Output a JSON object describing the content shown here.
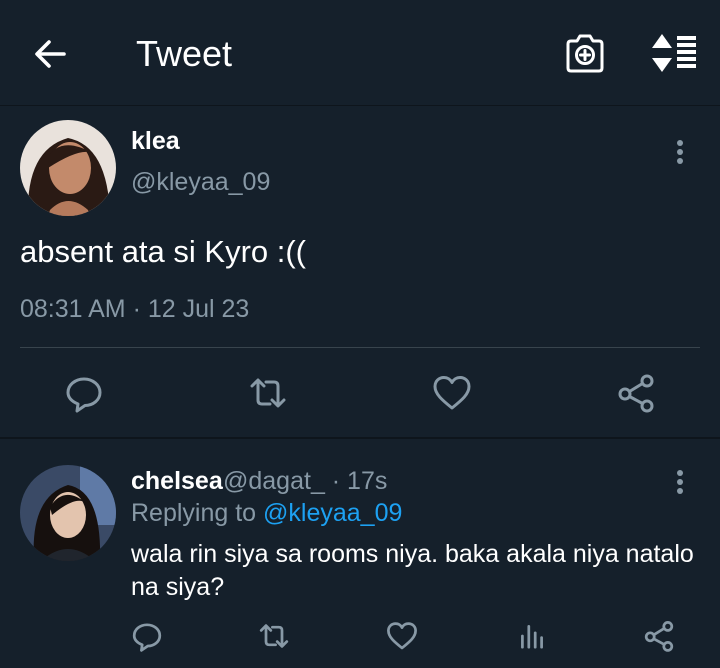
{
  "header": {
    "title": "Tweet",
    "back_icon": "arrow-left-icon",
    "camera_icon": "camera-add-icon",
    "sort_icon": "sort-list-icon"
  },
  "tweet": {
    "name": "klea",
    "handle": "@kleyaa_09",
    "text": "absent ata si Kyro :((",
    "timestamp": "08:31 AM · 12 Jul 23",
    "actions": [
      "reply-icon",
      "retweet-icon",
      "like-icon",
      "share-icon"
    ]
  },
  "reply": {
    "name": "chelsea",
    "handle_time": "@dagat_ · 17s",
    "replying_label": "Replying to",
    "replying_handle": "@kleyaa_09",
    "text": "wala rin siya sa rooms niya. baka akala niya natalo na siya?",
    "actions": [
      "reply-icon",
      "retweet-icon",
      "like-icon",
      "analytics-icon",
      "share-icon"
    ]
  },
  "colors": {
    "background": "#15202b",
    "secondary_text": "#8899a6",
    "link": "#1da1f2",
    "divider": "#38444d"
  }
}
